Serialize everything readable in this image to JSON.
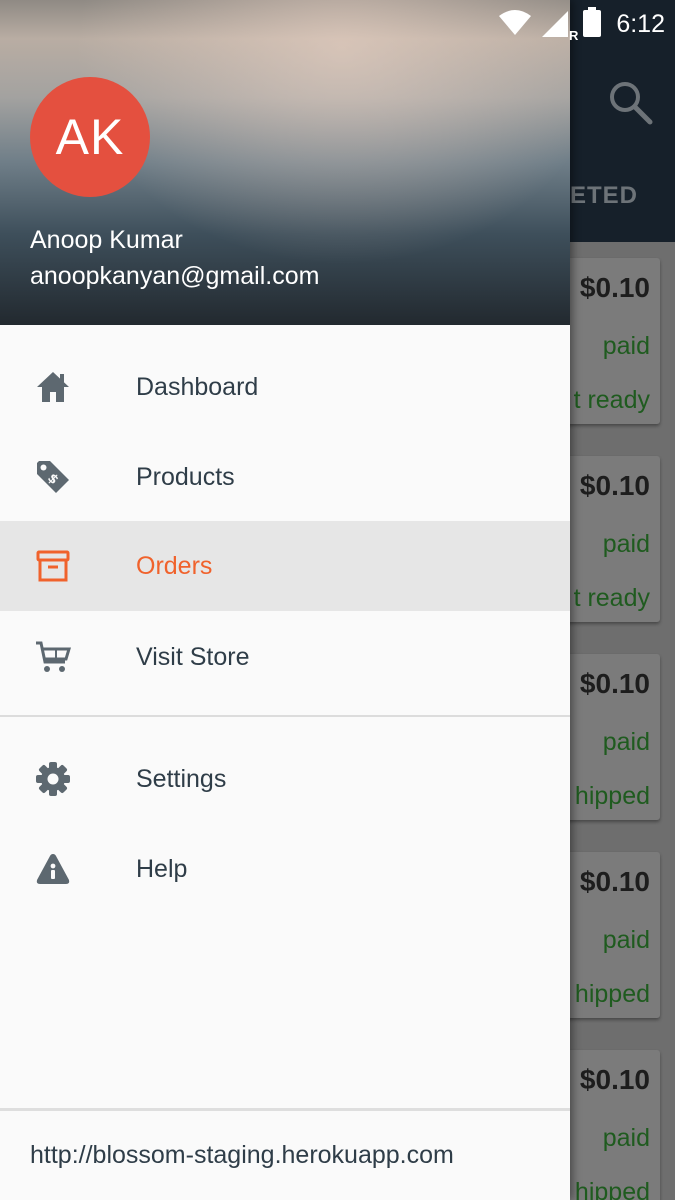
{
  "status_bar": {
    "time": "6:12",
    "icons": [
      "wifi-icon",
      "signal-icon",
      "battery-icon"
    ],
    "roaming_label": "R"
  },
  "background": {
    "tab_label": "LETED",
    "orders": [
      {
        "price": "$0.10",
        "payment": "paid",
        "status": "t ready"
      },
      {
        "price": "$0.10",
        "payment": "paid",
        "status": "t ready"
      },
      {
        "price": "$0.10",
        "payment": "paid",
        "status": "hipped"
      },
      {
        "price": "$0.10",
        "payment": "paid",
        "status": "hipped"
      },
      {
        "price": "$0.10",
        "payment": "paid",
        "status": "hipped"
      }
    ]
  },
  "drawer": {
    "avatar_initials": "AK",
    "user_name": "Anoop Kumar",
    "user_email": "anoopkanyan@gmail.com",
    "menu": [
      {
        "label": "Dashboard",
        "icon": "home-icon"
      },
      {
        "label": "Products",
        "icon": "tag-icon"
      },
      {
        "label": "Orders",
        "icon": "box-icon",
        "active": true
      },
      {
        "label": "Visit Store",
        "icon": "cart-icon"
      }
    ],
    "secondary_menu": [
      {
        "label": "Settings",
        "icon": "gear-icon"
      },
      {
        "label": "Help",
        "icon": "info-icon"
      }
    ],
    "footer_url": "http://blossom-staging.herokuapp.com"
  },
  "colors": {
    "accent": "#f0622c",
    "avatar": "#e4503f",
    "menu_text": "#2f3d48",
    "icon": "#5d6870"
  }
}
